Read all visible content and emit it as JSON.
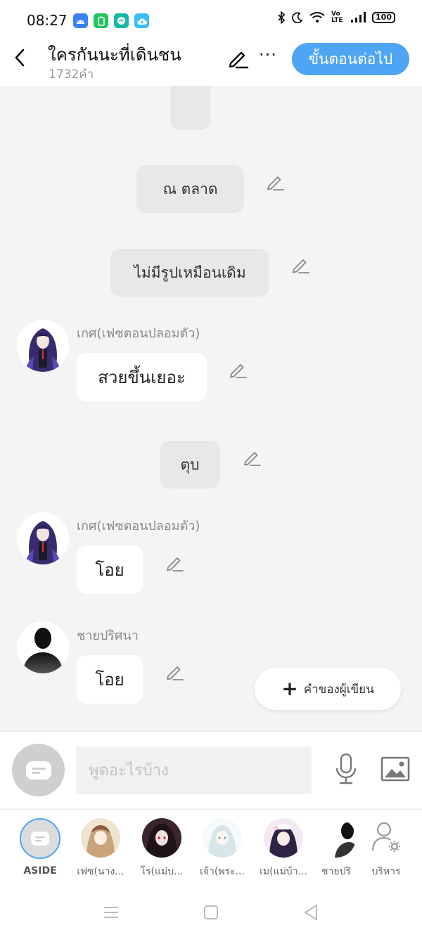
{
  "status_bar": {
    "time": "08:27",
    "network_label": "Vo LTE",
    "battery": "100"
  },
  "header": {
    "title": "ใครกันนะที่เดินชน",
    "word_count": "1732คำ",
    "next_label": "ขั้นตอนต่อไป",
    "more_label": "···"
  },
  "messages": {
    "narration_1": "ณ   ตลาด",
    "narration_2": "ไม่มีรูปเหมือนเดิม",
    "speaker_1": "เกศ(เฟซตอนปลอมตัว)",
    "bubble_1": "สวยขึ้นเยอะ",
    "narration_3": "ตุบ",
    "speaker_2": "เกศ(เฟซตอนปลอมตัว)",
    "bubble_2": "โอย",
    "speaker_3": "ชายปริศนา",
    "bubble_3": "โอย"
  },
  "writer_button_label": "คำของผู้เขียน",
  "input": {
    "placeholder": "พูดอะไรบ้าง"
  },
  "characters": [
    {
      "label": "ASIDE"
    },
    {
      "label": "เฟซ(นาง..."
    },
    {
      "label": "โร(แม่บ..."
    },
    {
      "label": "เจ้า(พระ..."
    },
    {
      "label": "เม(แม่บ้า..."
    },
    {
      "label": "ชายปริ"
    },
    {
      "label": "บริหาร"
    }
  ],
  "colors": {
    "accent": "#4ea5f3",
    "narration_bg": "#e8e8e8",
    "chat_bg": "#f4f4f4"
  }
}
